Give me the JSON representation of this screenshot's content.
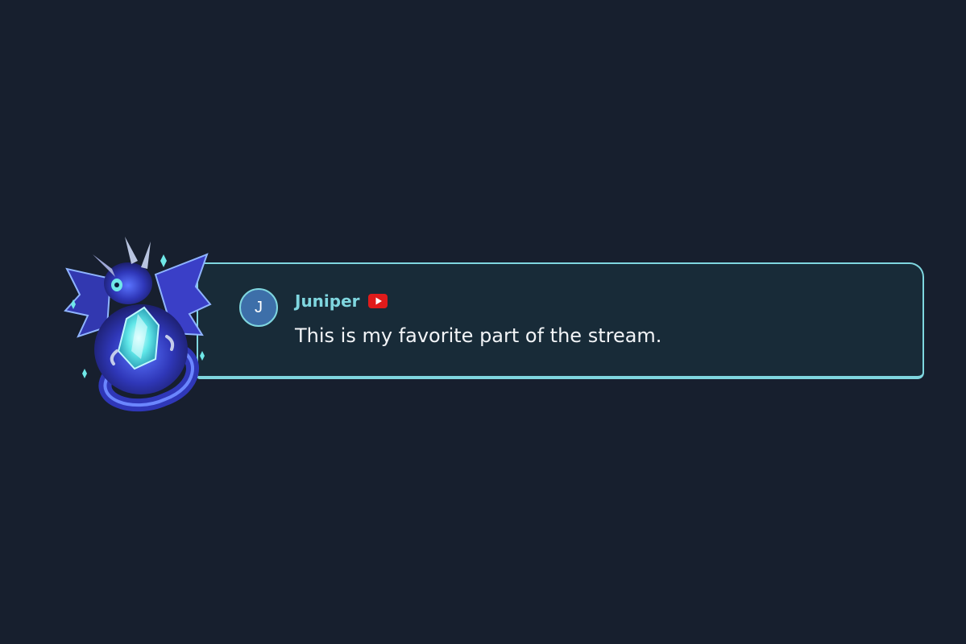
{
  "chat": {
    "avatar_initial": "J",
    "username": "Juniper",
    "platform_icon": "youtube-icon",
    "message": "This is my favorite part of the stream."
  },
  "colors": {
    "background": "#171f2e",
    "card_background": "#182b38",
    "accent": "#7fd6df",
    "avatar": "#3d6fa9",
    "youtube_red": "#e01b1b"
  },
  "decoration": {
    "mascot": "crystal-dragon-icon"
  }
}
